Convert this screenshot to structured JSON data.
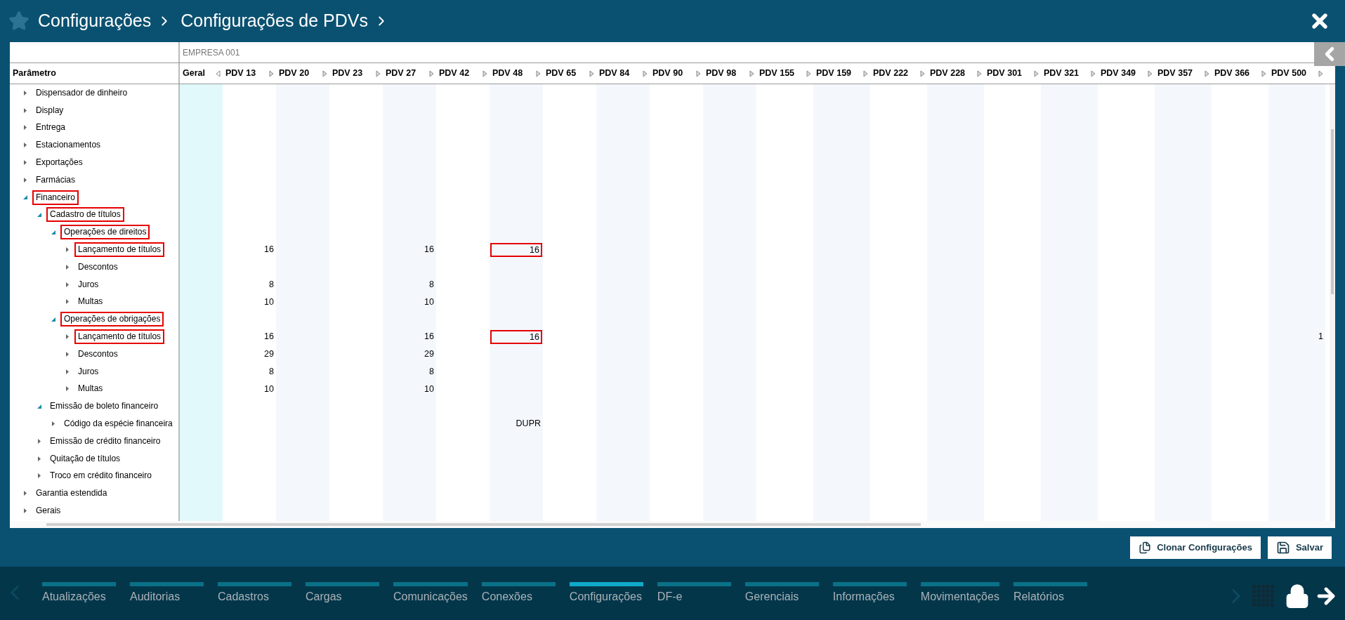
{
  "header": {
    "breadcrumbs": [
      {
        "label": "Configurações"
      },
      {
        "label": "Configurações de PDVs"
      }
    ]
  },
  "company": "EMPRESA 001",
  "parameter_heading": "Parâmetro",
  "columns": [
    {
      "label": "Geral",
      "expanded": true
    },
    {
      "label": "PDV 13",
      "expanded": false
    },
    {
      "label": "PDV 20",
      "expanded": false
    },
    {
      "label": "PDV 23",
      "expanded": false
    },
    {
      "label": "PDV 27",
      "expanded": false
    },
    {
      "label": "PDV 42",
      "expanded": false
    },
    {
      "label": "PDV 48",
      "expanded": false
    },
    {
      "label": "PDV 65",
      "expanded": false
    },
    {
      "label": "PDV 84",
      "expanded": false
    },
    {
      "label": "PDV 90",
      "expanded": false
    },
    {
      "label": "PDV 98",
      "expanded": false
    },
    {
      "label": "PDV 155",
      "expanded": false
    },
    {
      "label": "PDV 159",
      "expanded": false
    },
    {
      "label": "PDV 222",
      "expanded": false
    },
    {
      "label": "PDV 228",
      "expanded": false
    },
    {
      "label": "PDV 301",
      "expanded": false
    },
    {
      "label": "PDV 321",
      "expanded": false
    },
    {
      "label": "PDV 349",
      "expanded": false
    },
    {
      "label": "PDV 357",
      "expanded": false
    },
    {
      "label": "PDV 366",
      "expanded": false
    },
    {
      "label": "PDV 500",
      "expanded": false
    }
  ],
  "tree": [
    {
      "label": "Dispensador de dinheiro",
      "expanded": false,
      "highlighted": false
    },
    {
      "label": "Display",
      "expanded": false,
      "highlighted": false
    },
    {
      "label": "Entrega",
      "expanded": false,
      "highlighted": false
    },
    {
      "label": "Estacionamentos",
      "expanded": false,
      "highlighted": false
    },
    {
      "label": "Exportações",
      "expanded": false,
      "highlighted": false
    },
    {
      "label": "Farmácias",
      "expanded": false,
      "highlighted": false
    },
    {
      "label": "Financeiro",
      "expanded": true,
      "highlighted": true,
      "children": [
        {
          "label": "Cadastro de títulos",
          "expanded": true,
          "highlighted": true,
          "children": [
            {
              "label": "Operações de direitos",
              "expanded": true,
              "highlighted": true,
              "children": [
                {
                  "label": "Lançamento de títulos",
                  "expanded": false,
                  "highlighted": true,
                  "cells": [
                    {
                      "kind": "blank"
                    },
                    {
                      "kind": "value",
                      "text": "16",
                      "highlighted": false
                    },
                    {
                      "kind": "blank"
                    },
                    {
                      "kind": "blank"
                    },
                    {
                      "kind": "value",
                      "text": "16",
                      "highlighted": false
                    },
                    {
                      "kind": "blank"
                    },
                    {
                      "kind": "value",
                      "text": "16",
                      "highlighted": true
                    }
                  ]
                },
                {
                  "label": "Descontos",
                  "expanded": false,
                  "highlighted": false
                },
                {
                  "label": "Juros",
                  "expanded": false,
                  "highlighted": false,
                  "cells": [
                    {
                      "kind": "blank"
                    },
                    {
                      "kind": "value",
                      "text": "8",
                      "highlighted": false
                    },
                    {
                      "kind": "blank"
                    },
                    {
                      "kind": "blank"
                    },
                    {
                      "kind": "value",
                      "text": "8",
                      "highlighted": false
                    }
                  ]
                },
                {
                  "label": "Multas",
                  "expanded": false,
                  "highlighted": false,
                  "cells": [
                    {
                      "kind": "blank"
                    },
                    {
                      "kind": "value",
                      "text": "10",
                      "highlighted": false
                    },
                    {
                      "kind": "blank"
                    },
                    {
                      "kind": "blank"
                    },
                    {
                      "kind": "value",
                      "text": "10",
                      "highlighted": false
                    }
                  ]
                }
              ]
            },
            {
              "label": "Operações de obrigações",
              "expanded": true,
              "highlighted": true,
              "children": [
                {
                  "label": "Lançamento de títulos",
                  "expanded": false,
                  "highlighted": true,
                  "cells": [
                    {
                      "kind": "blank"
                    },
                    {
                      "kind": "value",
                      "text": "16",
                      "highlighted": false
                    },
                    {
                      "kind": "blank"
                    },
                    {
                      "kind": "blank"
                    },
                    {
                      "kind": "value",
                      "text": "16",
                      "highlighted": false
                    },
                    {
                      "kind": "blank"
                    },
                    {
                      "kind": "value",
                      "text": "16",
                      "highlighted": true
                    },
                    {
                      "kind": "blank"
                    },
                    {
                      "kind": "blank"
                    },
                    {
                      "kind": "blank"
                    },
                    {
                      "kind": "blank"
                    },
                    {
                      "kind": "blank"
                    },
                    {
                      "kind": "blank"
                    },
                    {
                      "kind": "blank"
                    },
                    {
                      "kind": "blank"
                    },
                    {
                      "kind": "blank"
                    },
                    {
                      "kind": "blank"
                    },
                    {
                      "kind": "blank"
                    },
                    {
                      "kind": "blank"
                    },
                    {
                      "kind": "blank"
                    },
                    {
                      "kind": "value",
                      "text": "1",
                      "highlighted": false
                    }
                  ]
                },
                {
                  "label": "Descontos",
                  "expanded": false,
                  "highlighted": false,
                  "cells": [
                    {
                      "kind": "blank"
                    },
                    {
                      "kind": "value",
                      "text": "29",
                      "highlighted": false
                    },
                    {
                      "kind": "blank"
                    },
                    {
                      "kind": "blank"
                    },
                    {
                      "kind": "value",
                      "text": "29",
                      "highlighted": false
                    }
                  ]
                },
                {
                  "label": "Juros",
                  "expanded": false,
                  "highlighted": false,
                  "cells": [
                    {
                      "kind": "blank"
                    },
                    {
                      "kind": "value",
                      "text": "8",
                      "highlighted": false
                    },
                    {
                      "kind": "blank"
                    },
                    {
                      "kind": "blank"
                    },
                    {
                      "kind": "value",
                      "text": "8",
                      "highlighted": false
                    }
                  ]
                },
                {
                  "label": "Multas",
                  "expanded": false,
                  "highlighted": false,
                  "cells": [
                    {
                      "kind": "blank"
                    },
                    {
                      "kind": "value",
                      "text": "10",
                      "highlighted": false
                    },
                    {
                      "kind": "blank"
                    },
                    {
                      "kind": "blank"
                    },
                    {
                      "kind": "value",
                      "text": "10",
                      "highlighted": false
                    }
                  ]
                }
              ]
            }
          ]
        },
        {
          "label": "Emissão de boleto financeiro",
          "expanded": true,
          "highlighted": false,
          "children": [
            {
              "label": "Código da espécie financeira",
              "expanded": false,
              "highlighted": false,
              "cells": [
                {
                  "kind": "blank"
                },
                {
                  "kind": "blank"
                },
                {
                  "kind": "blank"
                },
                {
                  "kind": "blank"
                },
                {
                  "kind": "blank"
                },
                {
                  "kind": "blank"
                },
                {
                  "kind": "value",
                  "text": "DUPR",
                  "highlighted": false
                }
              ]
            }
          ]
        },
        {
          "label": "Emissão de crédito financeiro",
          "expanded": false,
          "highlighted": false
        },
        {
          "label": "Quitação de títulos",
          "expanded": false,
          "highlighted": false
        },
        {
          "label": "Troco em crédito financeiro",
          "expanded": false,
          "highlighted": false
        }
      ]
    },
    {
      "label": "Garantia estendida",
      "expanded": false,
      "highlighted": false
    },
    {
      "label": "Gerais",
      "expanded": false,
      "highlighted": false
    }
  ],
  "actions": [
    {
      "label": "Clonar Configurações",
      "kind": "clone"
    },
    {
      "label": "Salvar",
      "kind": "save"
    }
  ],
  "nav": [
    {
      "label": "Atualizações",
      "selected": false
    },
    {
      "label": "Auditorias",
      "selected": false
    },
    {
      "label": "Cadastros",
      "selected": false
    },
    {
      "label": "Cargas",
      "selected": false
    },
    {
      "label": "Comunicações",
      "selected": false
    },
    {
      "label": "Conexões",
      "selected": false
    },
    {
      "label": "Configurações",
      "selected": true
    },
    {
      "label": "DF-e",
      "selected": false
    },
    {
      "label": "Gerenciais",
      "selected": false
    },
    {
      "label": "Informações",
      "selected": false
    },
    {
      "label": "Movimentações",
      "selected": false
    },
    {
      "label": "Relatórios",
      "selected": false
    }
  ]
}
